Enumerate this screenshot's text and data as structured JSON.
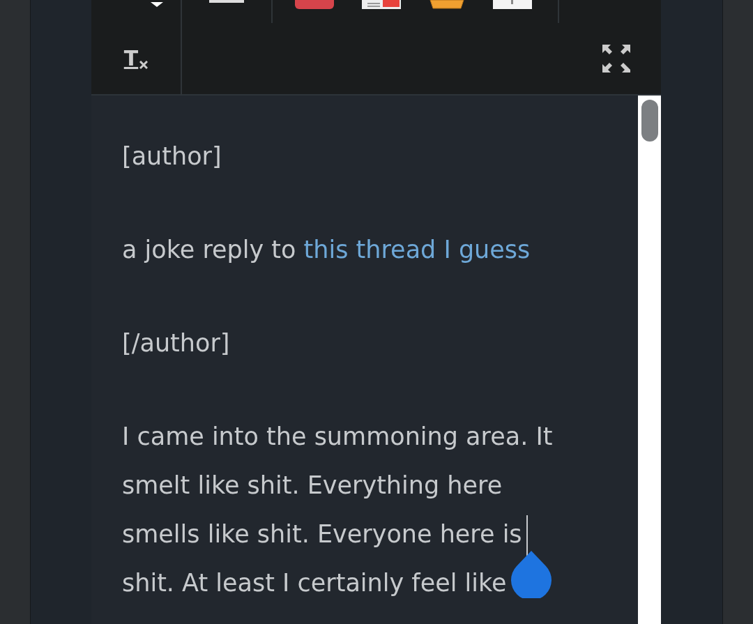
{
  "toolbar": {
    "clear_format_button": "T"
  },
  "editor": {
    "paragraphs": [
      {
        "kind": "plain",
        "lines": [
          "[author]"
        ]
      },
      {
        "kind": "link",
        "lines": [
          "a joke reply to "
        ],
        "link": "this thread I guess"
      },
      {
        "kind": "plain",
        "lines": [
          "[/author]"
        ]
      },
      {
        "kind": "caret",
        "lines": [
          "I came into the summoning area. It",
          "smelt like shit. Everything here",
          "smells like shit. Everyone here is",
          "shit. At least I certainly feel like"
        ]
      }
    ]
  }
}
